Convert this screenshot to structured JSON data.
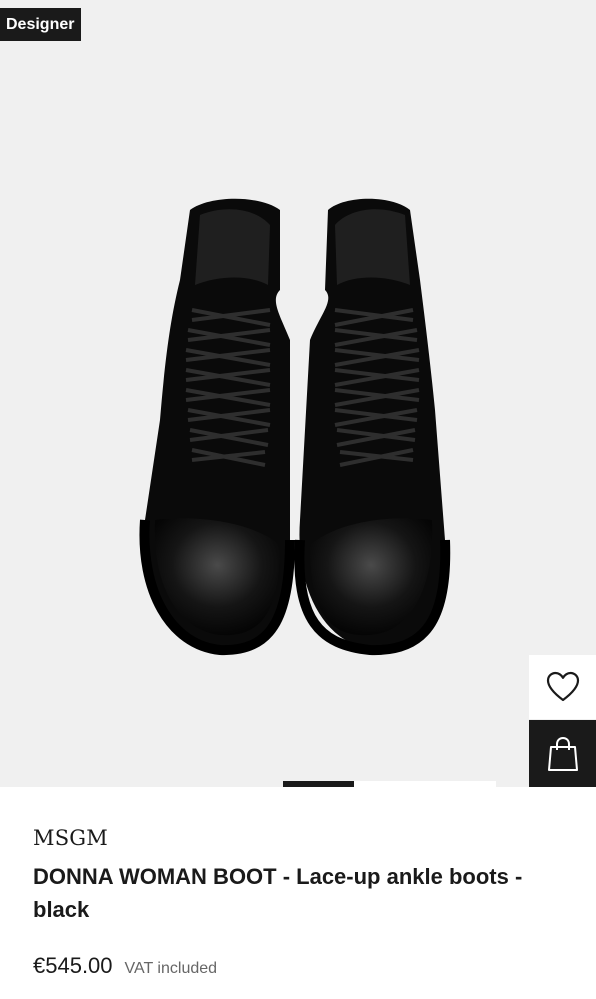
{
  "badge": {
    "label": "Designer"
  },
  "product": {
    "image_alt": "Black patent lace-up ankle boots",
    "brand": "MSGM",
    "title": "DONNA WOMAN BOOT - Lace-up ankle boots - black",
    "price": "€545.00",
    "vat_note": "VAT included"
  },
  "actions": {
    "wishlist_icon": "heart-icon",
    "bag_icon": "shopping-bag-icon"
  },
  "gallery": {
    "current_image": 2,
    "total_images": 3
  },
  "colors": {
    "accent": "#1a1a1a",
    "background": "#f0f0f0",
    "muted": "#666666"
  }
}
